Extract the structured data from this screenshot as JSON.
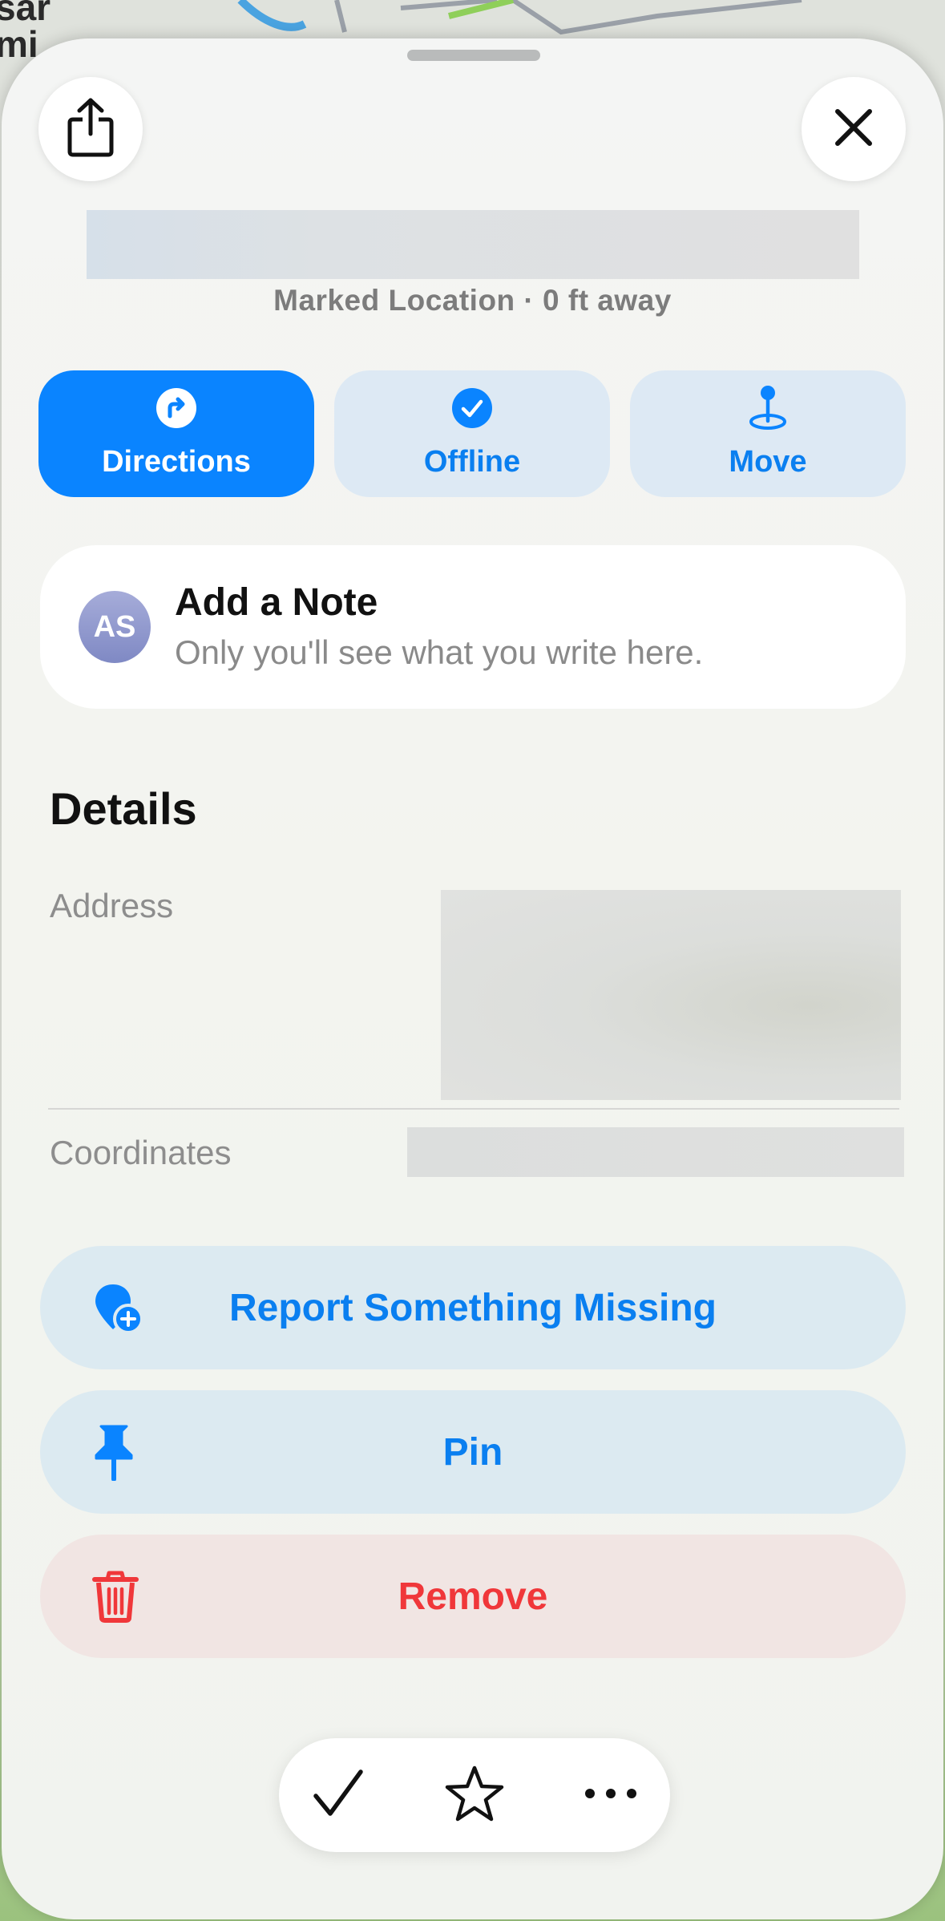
{
  "map": {
    "label_top": "sar",
    "label_bottom": "mi"
  },
  "header": {
    "share_icon": "share-icon",
    "close_icon": "close-icon",
    "subtitle": "Marked Location · 0 ft away"
  },
  "actions": [
    {
      "label": "Directions",
      "icon": "directions-icon"
    },
    {
      "label": "Offline",
      "icon": "checkmark-circle-icon"
    },
    {
      "label": "Move",
      "icon": "move-pin-icon"
    }
  ],
  "note": {
    "avatar_initials": "AS",
    "title": "Add a Note",
    "subtitle": "Only you'll see what you write here."
  },
  "details": {
    "heading": "Details",
    "address_label": "Address",
    "coordinates_label": "Coordinates"
  },
  "buttons": {
    "report": "Report Something Missing",
    "pin": "Pin",
    "remove": "Remove"
  },
  "toolbar": {
    "items": [
      "checkmark-icon",
      "star-icon",
      "more-icon"
    ]
  },
  "colors": {
    "accent": "#0a84ff",
    "accent_text": "#0a7ff0",
    "destructive": "#f0373a",
    "sheet": "#f3f4f2"
  }
}
